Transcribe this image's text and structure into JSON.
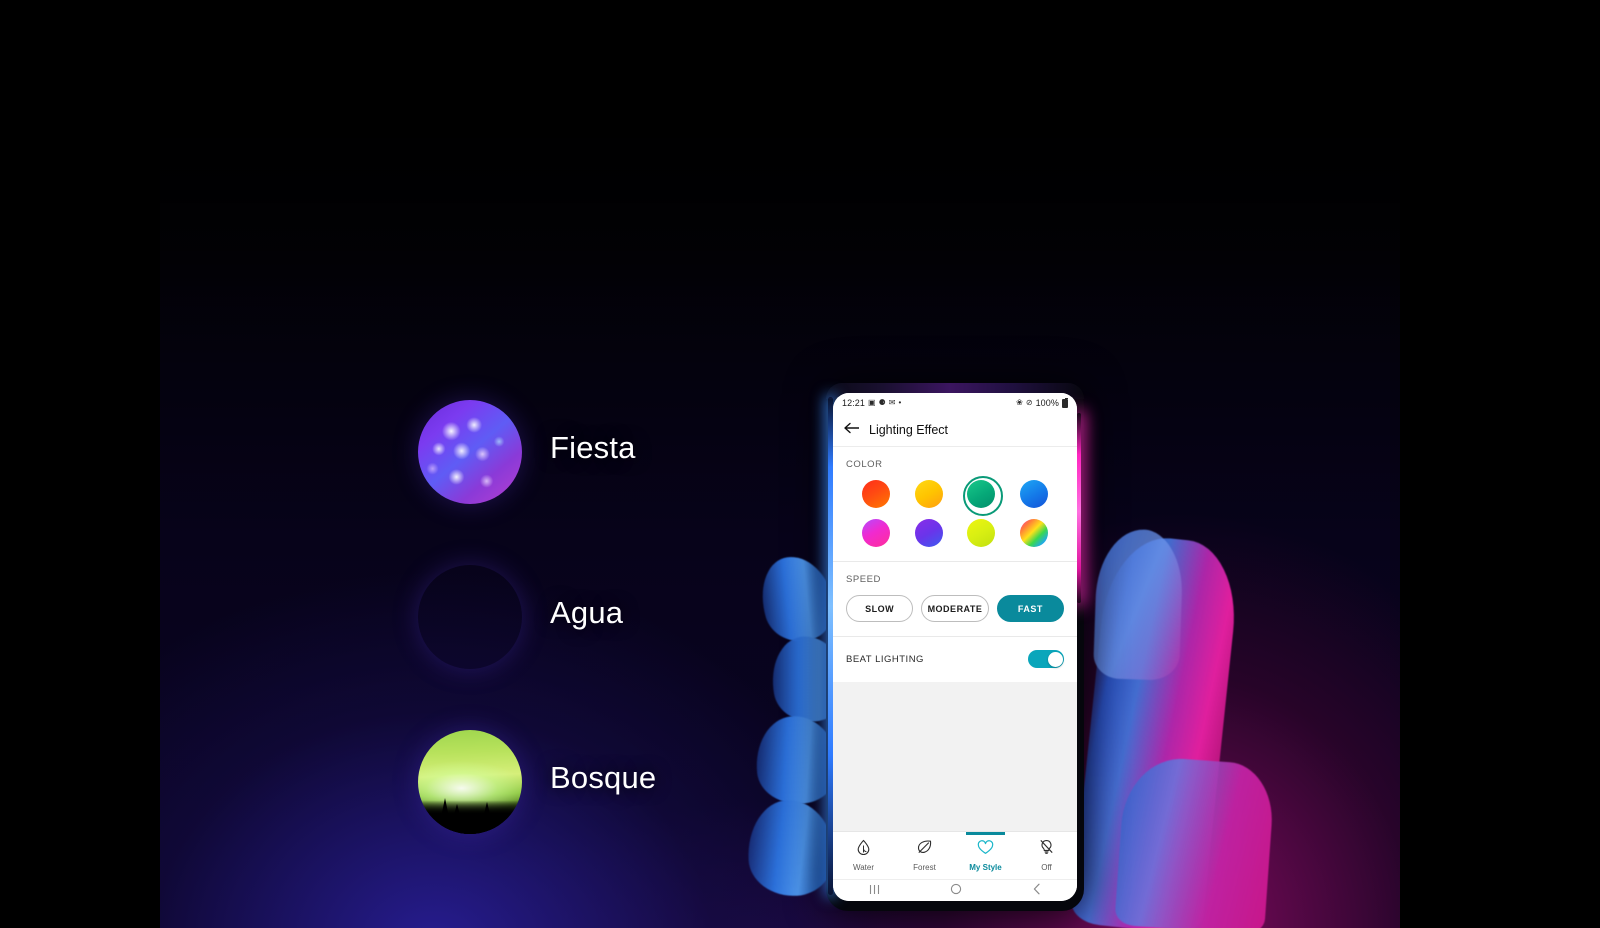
{
  "scene": {
    "background_colors": {
      "left_glow": "#281e96",
      "right_glow": "#960c69",
      "base": "#0b0426"
    },
    "edge_light_left": "#2f7bff",
    "edge_light_right": "#ff25c0"
  },
  "presets": [
    {
      "label": "Fiesta",
      "thumb": "bokeh-purple-thumbnail"
    },
    {
      "label": "Agua",
      "thumb": "water-caustics-thumbnail"
    },
    {
      "label": "Bosque",
      "thumb": "forest-aurora-thumbnail"
    }
  ],
  "phone": {
    "statusbar": {
      "time": "12:21",
      "left_icons": [
        "gallery-icon",
        "mute-icon",
        "messaging-icon",
        "dot-icon"
      ],
      "right_icons": [
        "bluetooth-icon",
        "do-not-disturb-icon"
      ],
      "battery_percent": "100%"
    },
    "appbar": {
      "back_icon": "back-arrow-icon",
      "title": "Lighting Effect"
    },
    "color_section": {
      "label": "COLOR",
      "selected_index": 2,
      "swatches": [
        {
          "name": "red-orange",
          "css": "linear-gradient(150deg,#ff2d1a 0%, #ff4a12 45%, #ff7a00 100%)"
        },
        {
          "name": "yellow-orange",
          "css": "linear-gradient(150deg,#ffd915 0%, #ffc400 50%, #ff9e12 100%)"
        },
        {
          "name": "green-teal",
          "css": "linear-gradient(150deg,#19c98a 0%, #06a878 55%, #038f6b 100%)"
        },
        {
          "name": "blue",
          "css": "linear-gradient(150deg,#1ea8f5 0%, #1478e8 55%, #1352d8 100%)"
        },
        {
          "name": "magenta-pink",
          "css": "linear-gradient(150deg,#b44bff 0%, #f02ad0 45%, #ff2d9a 100%)"
        },
        {
          "name": "purple-blue",
          "css": "linear-gradient(150deg,#8a2de8 0%, #6a34ea 50%, #3d5cf0 100%)"
        },
        {
          "name": "yellow-lime",
          "css": "linear-gradient(150deg,#eef510 0%, #d8ef12 50%, #c2e010 100%)"
        },
        {
          "name": "rainbow",
          "css": "linear-gradient(135deg,#ff2db4 0%, #ff7a3a 22%, #ffe01a 45%, #3ad84e 65%, #1fa8f0 85%, #7a3df0 100%)"
        }
      ]
    },
    "speed_section": {
      "label": "SPEED",
      "selected": "FAST",
      "options": [
        "SLOW",
        "MODERATE",
        "FAST"
      ],
      "active_color": "#0a8a9c"
    },
    "beat_section": {
      "label": "BEAT LIGHTING",
      "toggle_on": true,
      "toggle_color": "#0aa6bb"
    },
    "tabs": [
      {
        "label": "Water",
        "icon": "water-drop-icon",
        "active": false
      },
      {
        "label": "Forest",
        "icon": "leaf-icon",
        "active": false
      },
      {
        "label": "My Style",
        "icon": "heart-icon",
        "active": true
      },
      {
        "label": "Off",
        "icon": "bulb-off-icon",
        "active": false
      }
    ],
    "navbar": [
      {
        "name": "recents-button",
        "glyph": "|||"
      },
      {
        "name": "home-button",
        "glyph": "○"
      },
      {
        "name": "back-button",
        "glyph": "‹"
      }
    ]
  }
}
